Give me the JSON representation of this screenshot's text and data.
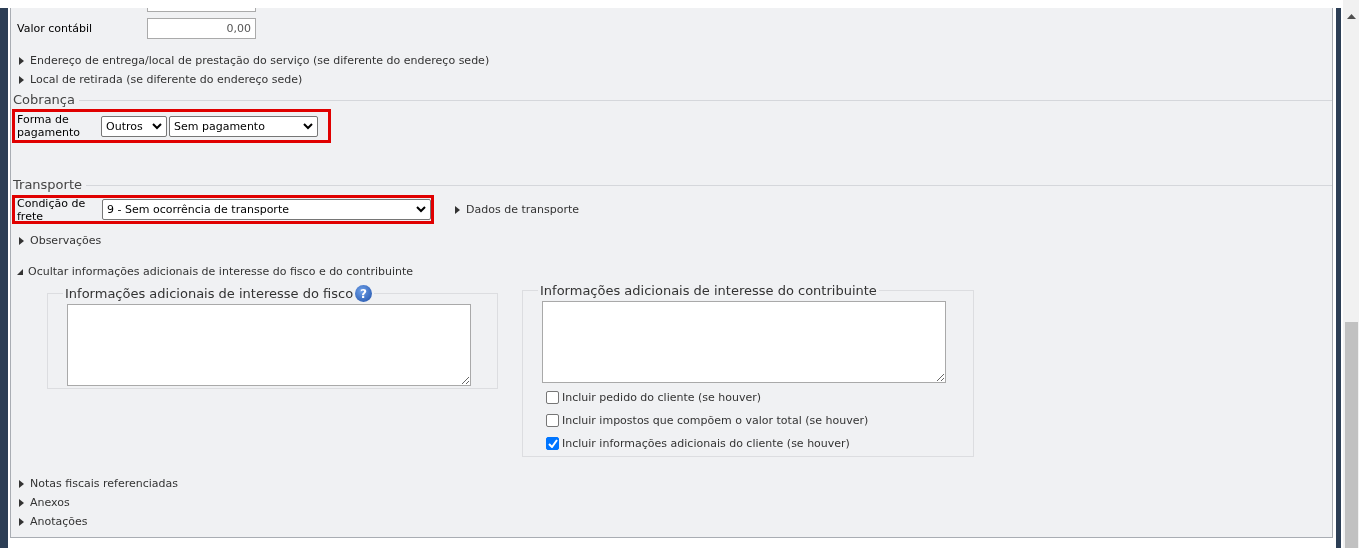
{
  "accounting_value": {
    "label": "Valor contábil",
    "value": "0,00"
  },
  "address_toggles": [
    {
      "label": "Endereço de entrega/local de prestação do serviço (se diferente do endereço sede)",
      "expanded": false
    },
    {
      "label": "Local de retirada (se diferente do endereço sede)",
      "expanded": false
    }
  ],
  "billing": {
    "title": "Cobrança",
    "highlighted": true,
    "field": {
      "label": "Forma de pagamento",
      "selects": [
        "Outros",
        "Sem pagamento"
      ]
    }
  },
  "transport": {
    "title": "Transporte",
    "highlighted": true,
    "field": {
      "label": "Condição de frete",
      "select": "9 - Sem ocorrência de transporte"
    },
    "details_toggle": {
      "label": "Dados de transporte",
      "expanded": false
    }
  },
  "notes_toggle": {
    "label": "Observações",
    "expanded": false
  },
  "additional_info_toggle": {
    "label": "Ocultar informações adicionais de interesse do fisco e do contribuinte",
    "expanded": true
  },
  "additional_info": [
    {
      "title": "Informações adicionais de interesse do fisco",
      "help": "?"
    },
    {
      "title": "Informações adicionais de interesse do contribuinte",
      "options": [
        {
          "label": "Incluir pedido do cliente (se houver)",
          "checked": false
        },
        {
          "label": "Incluir impostos que compõem o valor total (se houver)",
          "checked": false
        },
        {
          "label": "Incluir informações adicionais do cliente (se houver)",
          "checked": true
        }
      ]
    }
  ],
  "bottom_toggles": [
    {
      "label": "Notas fiscais referenciadas",
      "expanded": false
    },
    {
      "label": "Anexos",
      "expanded": false
    },
    {
      "label": "Anotações",
      "expanded": false
    }
  ]
}
